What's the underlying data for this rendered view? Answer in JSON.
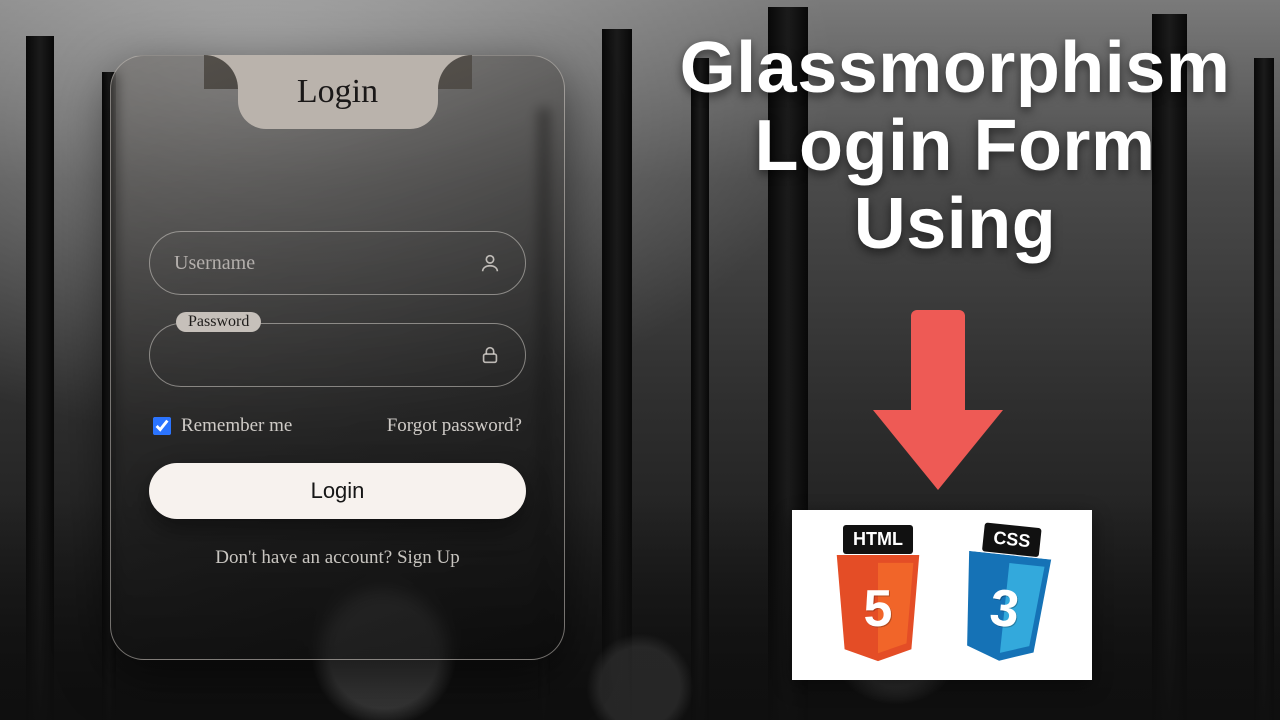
{
  "headline": {
    "line1": "Glassmorphism",
    "line2": "Login Form",
    "line3": "Using"
  },
  "login": {
    "title": "Login",
    "username_placeholder": "Username",
    "password_label": "Password",
    "remember_label": "Remember me",
    "remember_checked": true,
    "forgot_label": "Forgot password?",
    "submit_label": "Login",
    "signup_prefix": "Don't have an account? ",
    "signup_link": "Sign Up"
  },
  "logos": {
    "html_label": "HTML",
    "html_number": "5",
    "css_label": "CSS",
    "css_number": "3"
  },
  "colors": {
    "arrow": "#ee5a55",
    "html_shield": "#e44d26",
    "css_shield": "#1572b6"
  }
}
